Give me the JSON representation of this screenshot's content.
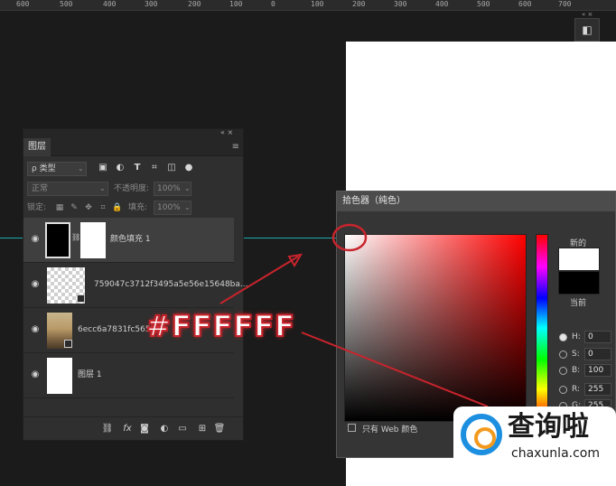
{
  "ruler": {
    "labels": [
      "600",
      "500",
      "400",
      "300",
      "200",
      "100",
      "0",
      "100",
      "200",
      "300",
      "400",
      "500",
      "600",
      "700"
    ]
  },
  "dock": {
    "top_label": "«  ×",
    "button_glyph": "◧"
  },
  "layers_panel": {
    "header_controls": "«   ×",
    "tab": "图层",
    "menu_glyph": "≡",
    "filter": {
      "kind_label": "ρ 类型"
    },
    "blend": {
      "mode": "正常",
      "opacity_label": "不透明度:",
      "opacity_value": "100%"
    },
    "lock": {
      "label": "锁定:",
      "fill_label": "填充:",
      "fill_value": "100%"
    },
    "layers": [
      {
        "name": "颜色填充 1",
        "visible": true,
        "thumb": "black",
        "mask": "white",
        "active": true
      },
      {
        "name": "759047c3712f3495a5e56e15648ba...",
        "visible": true,
        "thumb": "checker"
      },
      {
        "name": "6ecc6a7831fc565290",
        "visible": true,
        "thumb": "photo"
      },
      {
        "name": "图层 1",
        "visible": true,
        "thumb": "white"
      }
    ],
    "footer_icons": [
      "link-icon",
      "fx-icon",
      "mask-icon",
      "adjustment-icon",
      "folder-icon",
      "new-layer-icon",
      "trash-icon"
    ],
    "footer_fx_label": "fx"
  },
  "color_picker": {
    "title": "拾色器（纯色）",
    "new_label": "新的",
    "current_label": "当前",
    "new_color": "#ffffff",
    "current_color": "#000000",
    "fields": [
      {
        "label": "H:",
        "value": "0",
        "selected": true
      },
      {
        "label": "S:",
        "value": "0",
        "selected": false
      },
      {
        "label": "B:",
        "value": "100",
        "selected": false
      },
      {
        "label": "R:",
        "value": "255",
        "selected": false
      },
      {
        "label": "G:",
        "value": "255",
        "selected": false
      }
    ],
    "web_colors_label": "只有 Web 颜色"
  },
  "annotation": {
    "hex": "#FFFFFF",
    "color": "#c8242c"
  },
  "watermark": {
    "main": "查询啦",
    "sub": "chaxunla.com"
  }
}
